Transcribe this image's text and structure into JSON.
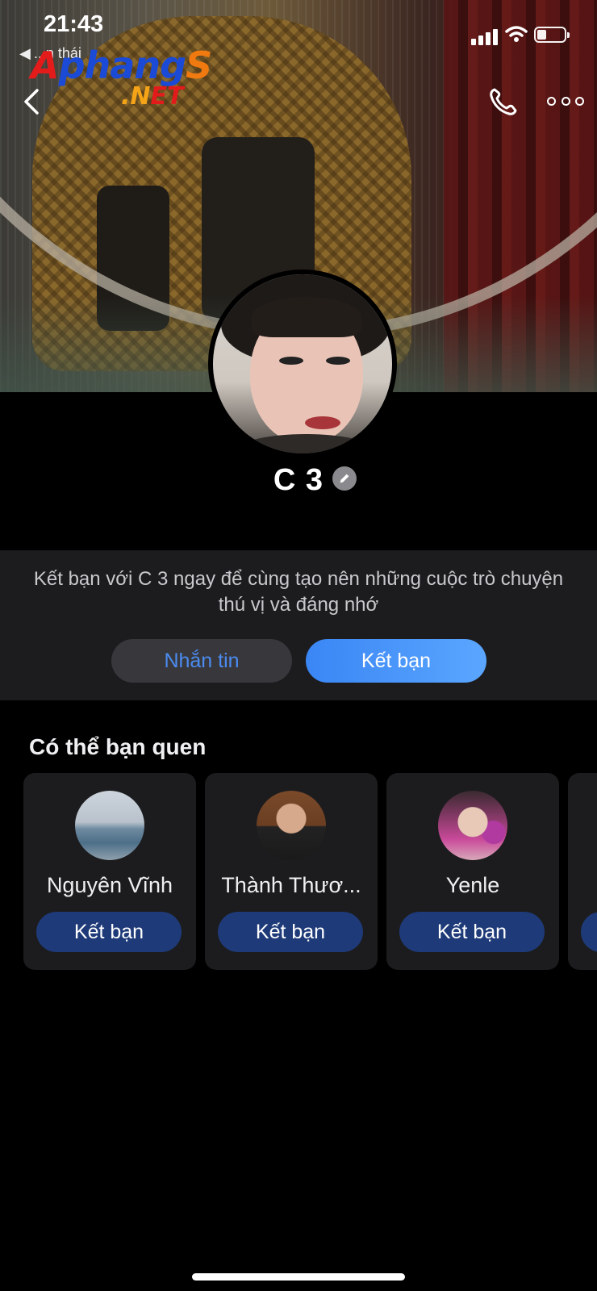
{
  "status_bar": {
    "time": "21:43",
    "back_app": "...n thái",
    "battery_level": 0.35
  },
  "watermark": {
    "brand_a": "A",
    "brand_b": "phang",
    "brand_c": "S",
    "tld_a": ".N",
    "tld_b": "ET"
  },
  "header": {
    "back_icon": "chevron-left-icon",
    "call_icon": "phone-icon",
    "more_icon": "more-horizontal-icon"
  },
  "profile": {
    "name": "C 3",
    "edit_icon": "pencil-icon"
  },
  "invite": {
    "message": "Kết bạn với C 3 ngay để cùng tạo nên những cuộc trò chuyện thú vị và đáng nhớ",
    "message_button": "Nhắn tin",
    "add_friend_button": "Kết bạn"
  },
  "suggestions": {
    "title": "Có thể bạn quen",
    "items": [
      {
        "name": "Nguyên Vĩnh",
        "button": "Kết bạn"
      },
      {
        "name": "Thành Thươ...",
        "button": "Kết bạn"
      },
      {
        "name": "Yenle",
        "button": "Kết bạn"
      }
    ]
  },
  "colors": {
    "accent_blue": "#3a86f5",
    "dark_button": "#1e3a78",
    "panel": "#1c1c1e"
  }
}
